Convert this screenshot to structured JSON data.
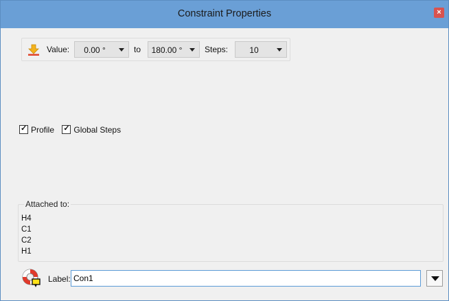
{
  "window": {
    "title": "Constraint Properties",
    "close_label": "×",
    "titlebar_color": "#6a9fd6"
  },
  "value_group": {
    "icon": "download-arrow-icon",
    "value_label": "Value:",
    "from_value": "0.00 °",
    "to_label": "to",
    "to_value": "180.00 °",
    "steps_label": "Steps:",
    "steps_value": "10"
  },
  "options": {
    "profile_label": "Profile",
    "profile_checked": true,
    "global_steps_label": "Global Steps",
    "global_steps_checked": true,
    "check_mark": "✓"
  },
  "attached": {
    "legend": "Attached to:",
    "atoms": [
      "H4",
      "C1",
      "C2",
      "H1"
    ]
  },
  "label_row": {
    "icon": "lifebuoy-icon",
    "label": "Label:",
    "value": "Con1"
  }
}
